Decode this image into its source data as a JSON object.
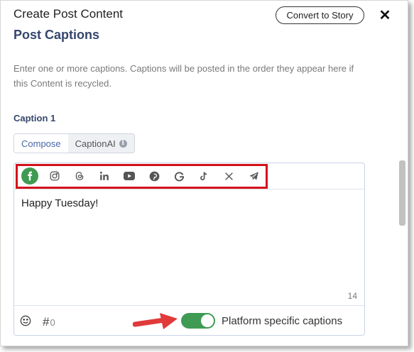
{
  "header": {
    "title": "Create Post Content",
    "convert_label": "Convert to Story",
    "close_symbol": "✕"
  },
  "section_title": "Post Captions",
  "description": "Enter one or more captions. Captions will be posted in the order they appear here if this Content is recycled.",
  "caption": {
    "label": "Caption 1",
    "tabs": [
      {
        "label": "Compose",
        "active": true
      },
      {
        "label": "CaptionAI",
        "active": false
      }
    ],
    "info_symbol": "i",
    "platforms": [
      {
        "name": "facebook-icon",
        "selected": true
      },
      {
        "name": "instagram-icon",
        "selected": false
      },
      {
        "name": "threads-icon",
        "selected": false
      },
      {
        "name": "linkedin-icon",
        "selected": false
      },
      {
        "name": "youtube-icon",
        "selected": false
      },
      {
        "name": "pinterest-icon",
        "selected": false
      },
      {
        "name": "google-icon",
        "selected": false
      },
      {
        "name": "tiktok-icon",
        "selected": false
      },
      {
        "name": "x-icon",
        "selected": false
      },
      {
        "name": "telegram-icon",
        "selected": false
      }
    ],
    "text": "Happy Tuesday!",
    "char_count": "14",
    "hashtag_symbol": "#",
    "hashtag_count": "0",
    "platform_specific_label": "Platform specific captions",
    "platform_specific_on": true
  },
  "colors": {
    "accent_green": "#3f9b53",
    "title_navy": "#35466d",
    "highlight_red": "#d3111b",
    "arrow_red": "#e03a3a"
  }
}
